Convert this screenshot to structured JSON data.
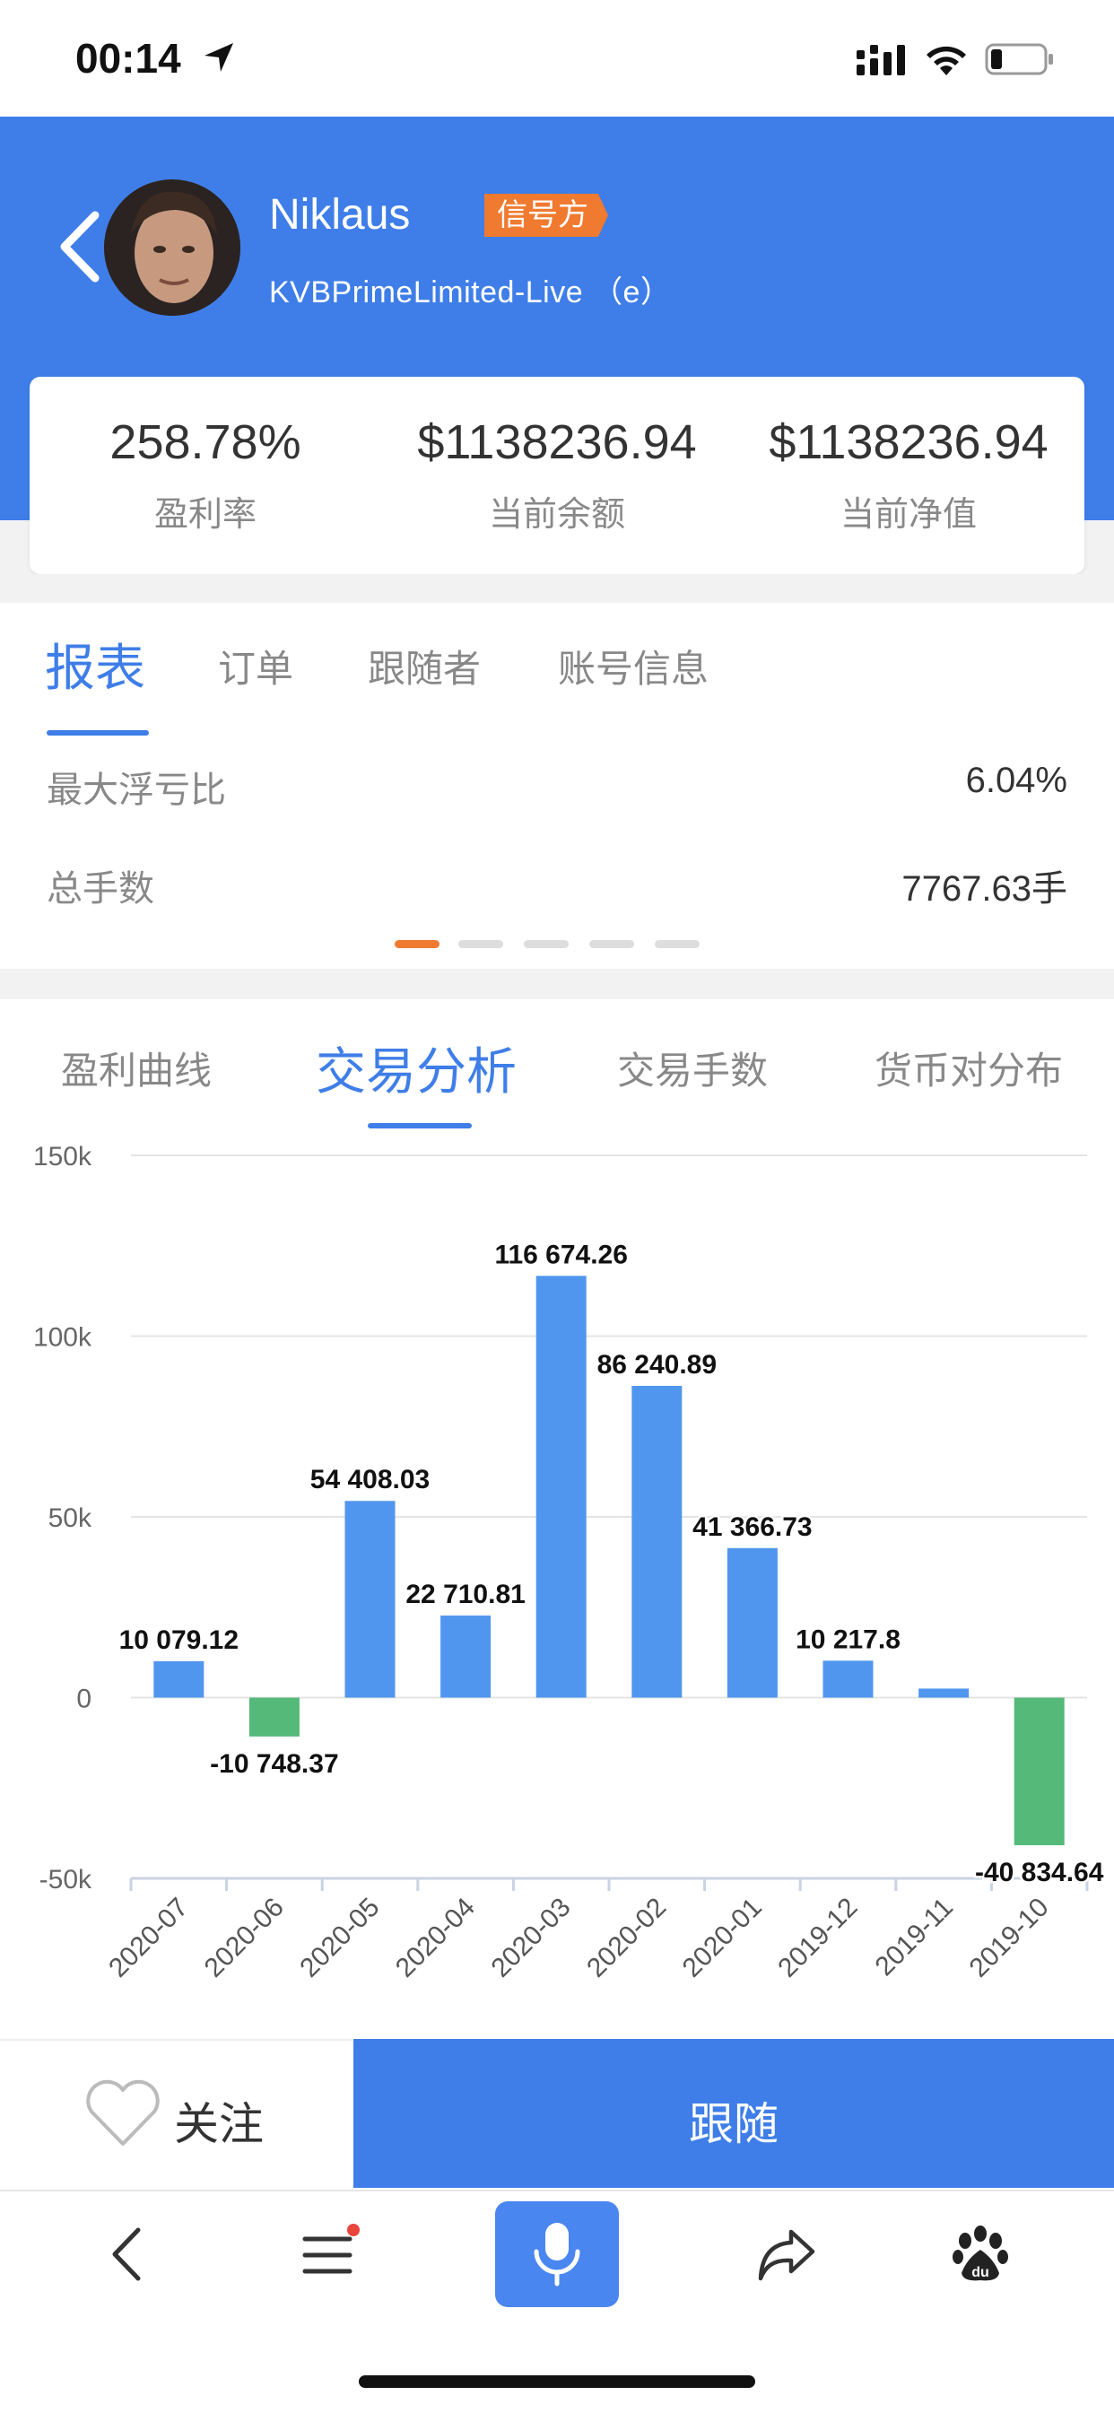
{
  "status_bar": {
    "time": "00:14"
  },
  "header": {
    "username": "Niklaus",
    "badge": "信号方",
    "account": "KVBPrimeLimited-Live （e）"
  },
  "stats": [
    {
      "value": "258.78%",
      "label": "盈利率"
    },
    {
      "value": "$1138236.94",
      "label": "当前余额"
    },
    {
      "value": "$1138236.94",
      "label": "当前净值"
    }
  ],
  "report_tabs": [
    {
      "label": "报表",
      "active": true
    },
    {
      "label": "订单",
      "active": false
    },
    {
      "label": "跟随者",
      "active": false
    },
    {
      "label": "账号信息",
      "active": false
    }
  ],
  "report_rows": [
    {
      "label": "最大浮亏比",
      "value": "6.04%"
    },
    {
      "label": "总手数",
      "value": "7767.63手"
    }
  ],
  "pager": {
    "count": 5,
    "active_index": 0
  },
  "chart_tabs": [
    {
      "label": "盈利曲线",
      "active": false
    },
    {
      "label": "交易分析",
      "active": true
    },
    {
      "label": "交易手数",
      "active": false
    },
    {
      "label": "货币对分布",
      "active": false
    }
  ],
  "chart_data": {
    "type": "bar",
    "categories": [
      "2020-07",
      "2020-06",
      "2020-05",
      "2020-04",
      "2020-03",
      "2020-02",
      "2020-01",
      "2019-12",
      "2019-11",
      "2019-10"
    ],
    "values": [
      10079.12,
      -10748.37,
      54408.03,
      22710.81,
      116674.26,
      86240.89,
      41366.73,
      10217.8,
      2500,
      -40834.64
    ],
    "data_labels": [
      "10 079.12",
      "-10 748.37",
      "54 408.03",
      "22 710.81",
      "116 674.26",
      "86 240.89",
      "41 366.73",
      "10 217.8",
      "",
      "-40 834.64"
    ],
    "ylim": [
      -50000,
      150000
    ],
    "y_ticks": [
      150000,
      100000,
      50000,
      0,
      -50000
    ],
    "y_tick_labels": [
      "150k",
      "100k",
      "50k",
      "0",
      "-50k"
    ],
    "colors": {
      "positive": "#5196ee",
      "negative": "#55b97a"
    },
    "grid": true
  },
  "actions": {
    "follow": "关注",
    "copy": "跟随"
  },
  "colors": {
    "accent": "#3f7ee8",
    "badge": "#f07a30"
  },
  "toolbar_icons": [
    "back-icon",
    "menu-icon",
    "microphone-icon",
    "share-icon",
    "baidu-paw-icon"
  ]
}
